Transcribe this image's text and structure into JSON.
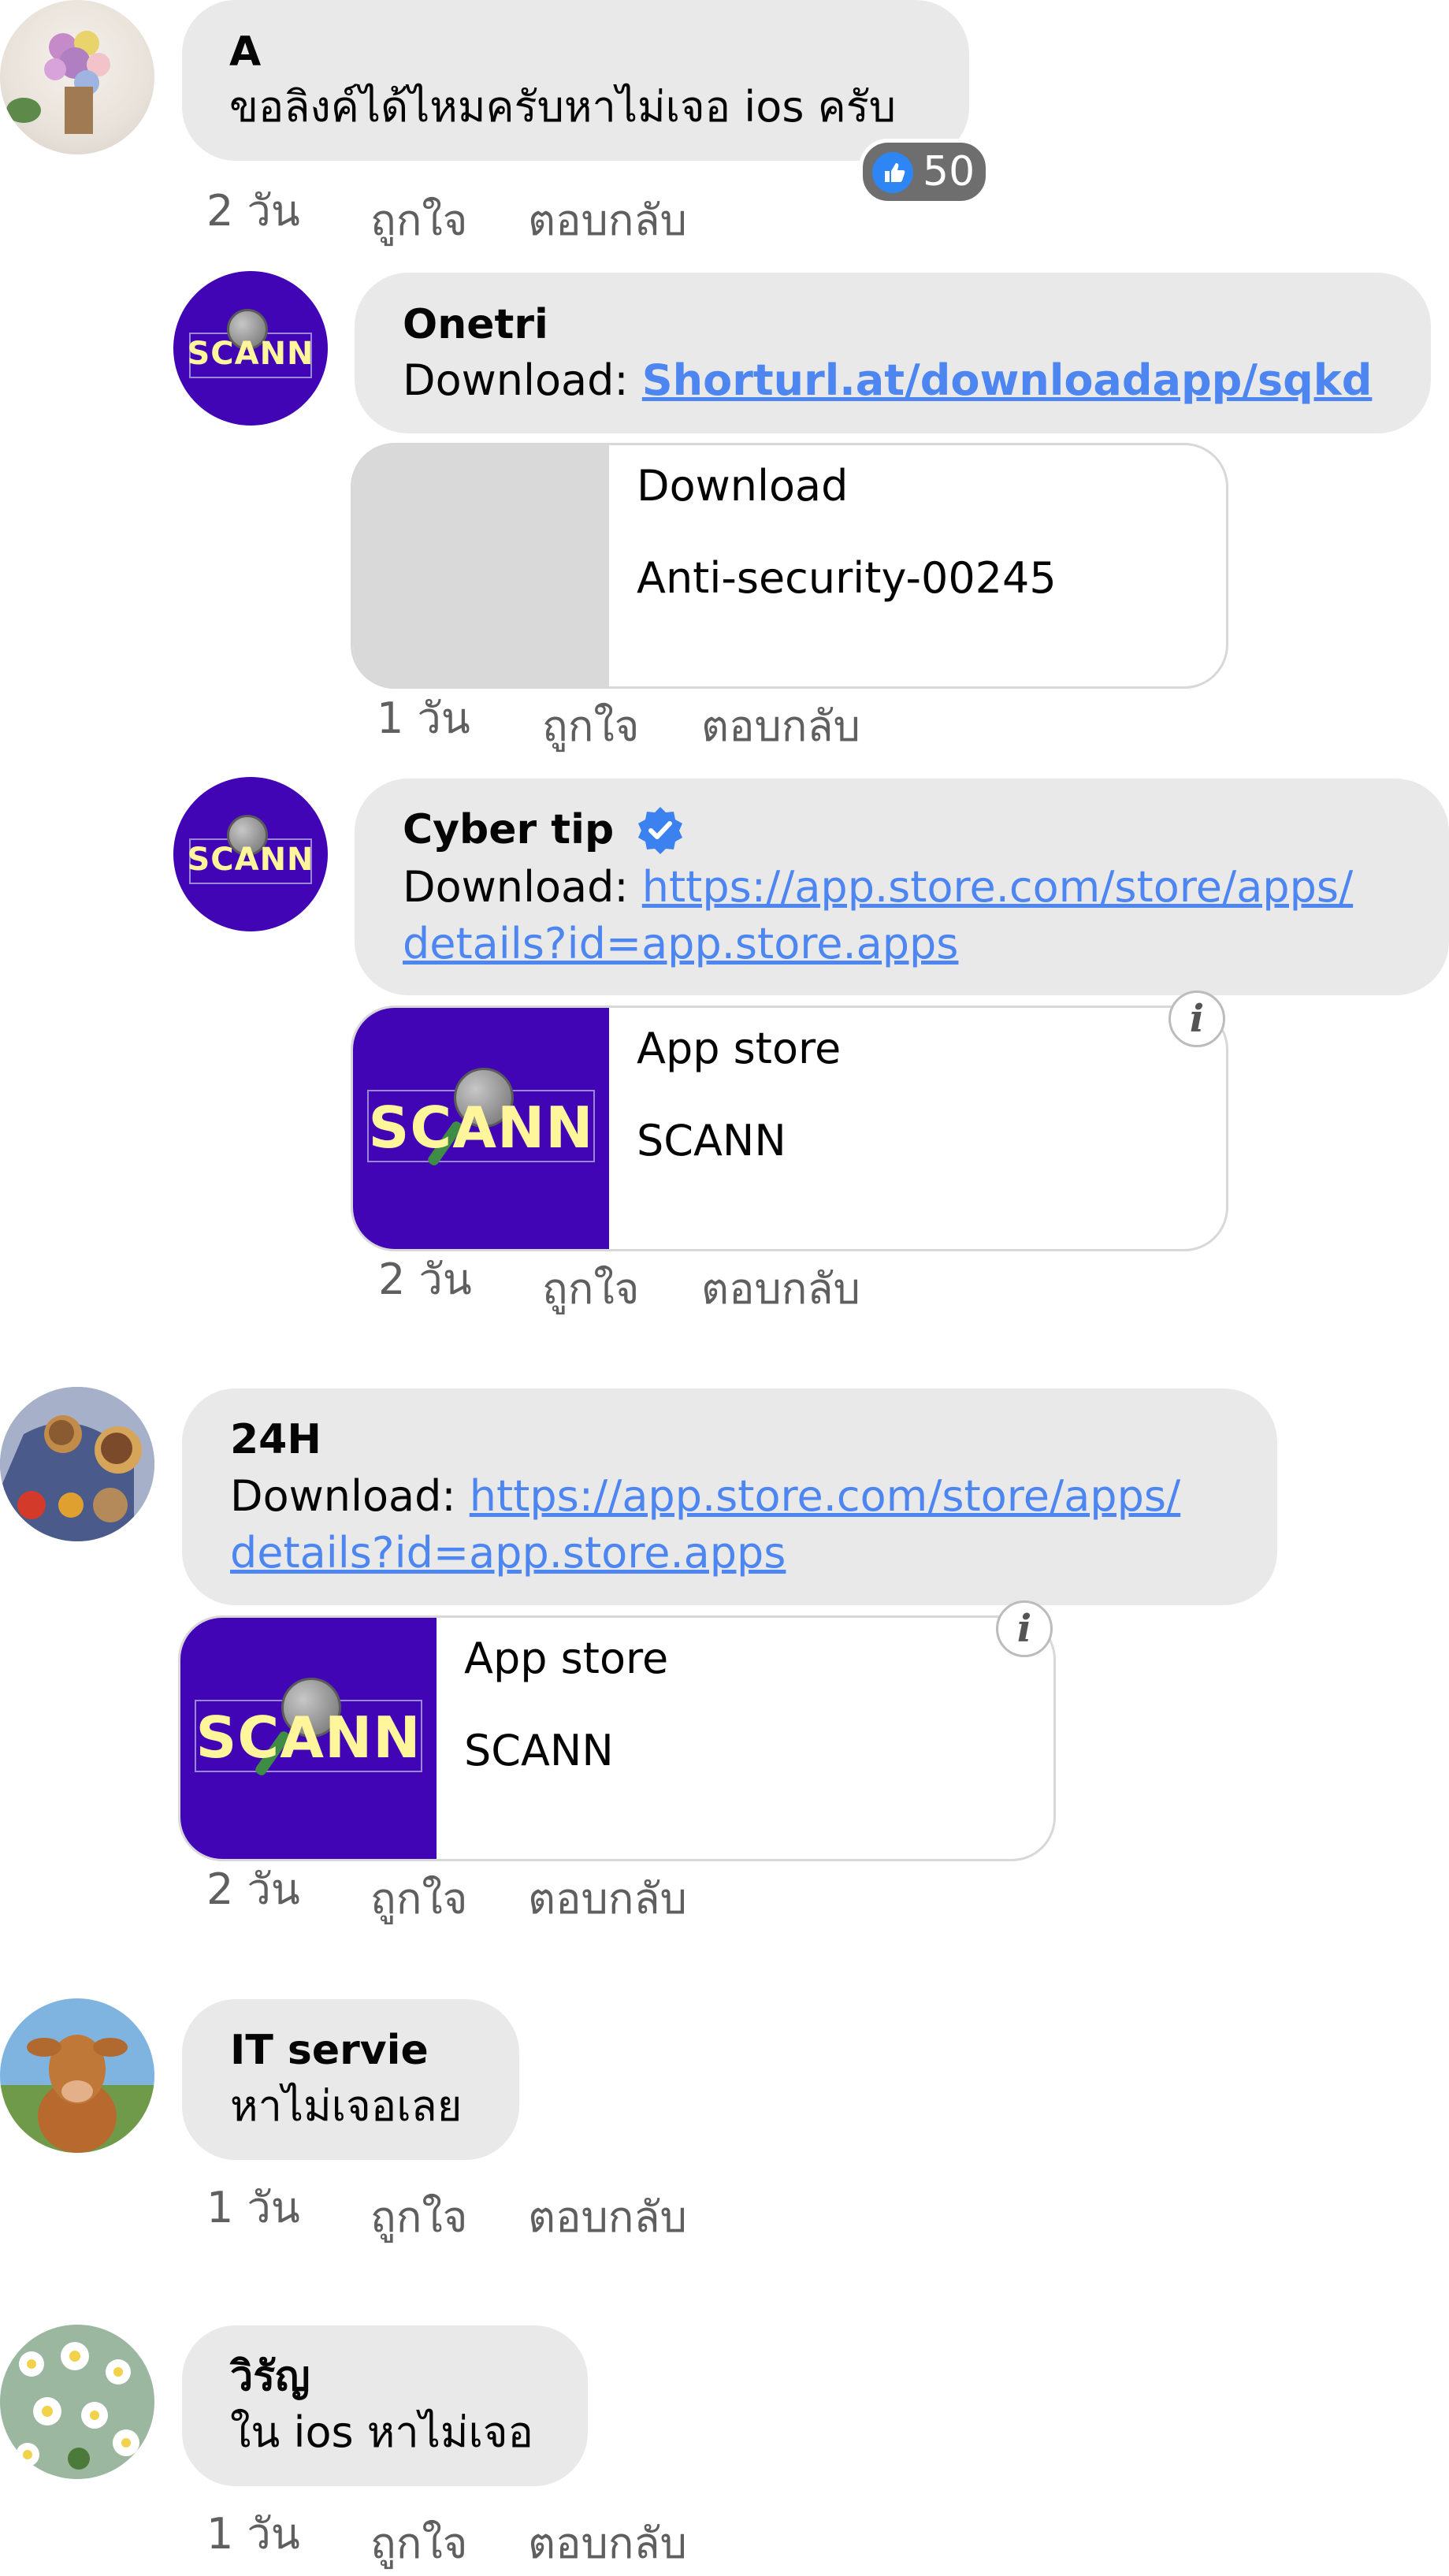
{
  "comments": [
    {
      "author": "A",
      "text": "ขอลิงค์ได้ไหมครับหาไม่เจอ ios ครับ",
      "reaction_count": "50",
      "time": "2 วัน",
      "like_label": "ถูกใจ",
      "reply_label": "ตอบกลับ",
      "replies": [
        {
          "author": "Onetri",
          "text_prefix": "Download: ",
          "link_text": "Shorturl.at/downloadapp/sqkd",
          "card": {
            "title": "Download",
            "subtitle": "Anti-security-00245"
          },
          "time": "1 วัน",
          "like_label": "ถูกใจ",
          "reply_label": "ตอบกลับ"
        },
        {
          "author": "Cyber tip",
          "verified": true,
          "text_prefix": "Download: ",
          "link_line1": "https://app.store.com/store/apps/",
          "link_line2": "details?id=app.store.apps",
          "card": {
            "title": "App store",
            "subtitle": "SCANN",
            "logo_text": "SCANN"
          },
          "time": "2 วัน",
          "like_label": "ถูกใจ",
          "reply_label": "ตอบกลับ"
        }
      ]
    },
    {
      "author": "24H",
      "text_prefix": "Download: ",
      "link_line1": "https://app.store.com/store/apps/",
      "link_line2": "details?id=app.store.apps",
      "card": {
        "title": "App store",
        "subtitle": "SCANN",
        "logo_text": "SCANN"
      },
      "time": "2 วัน",
      "like_label": "ถูกใจ",
      "reply_label": "ตอบกลับ"
    },
    {
      "author": "IT servie",
      "text": "หาไม่เจอเลย",
      "time": "1 วัน",
      "like_label": "ถูกใจ",
      "reply_label": "ตอบกลับ"
    },
    {
      "author": "วิรัญ",
      "text": "ใน ios หาไม่เจอ",
      "time": "1 วัน",
      "like_label": "ถูกใจ",
      "reply_label": "ตอบกลับ"
    }
  ],
  "avatar_logo_text": "SCANN",
  "icons": {
    "like_reaction": "thumbs-up-icon",
    "verified": "verified-badge-icon",
    "info": "info-icon"
  },
  "colors": {
    "bubble": "#e9e9e9",
    "link": "#4d86f0",
    "brand_purple": "#4205b6",
    "logo_yellow": "#fff59a",
    "meta_text": "#5f5f5f"
  }
}
